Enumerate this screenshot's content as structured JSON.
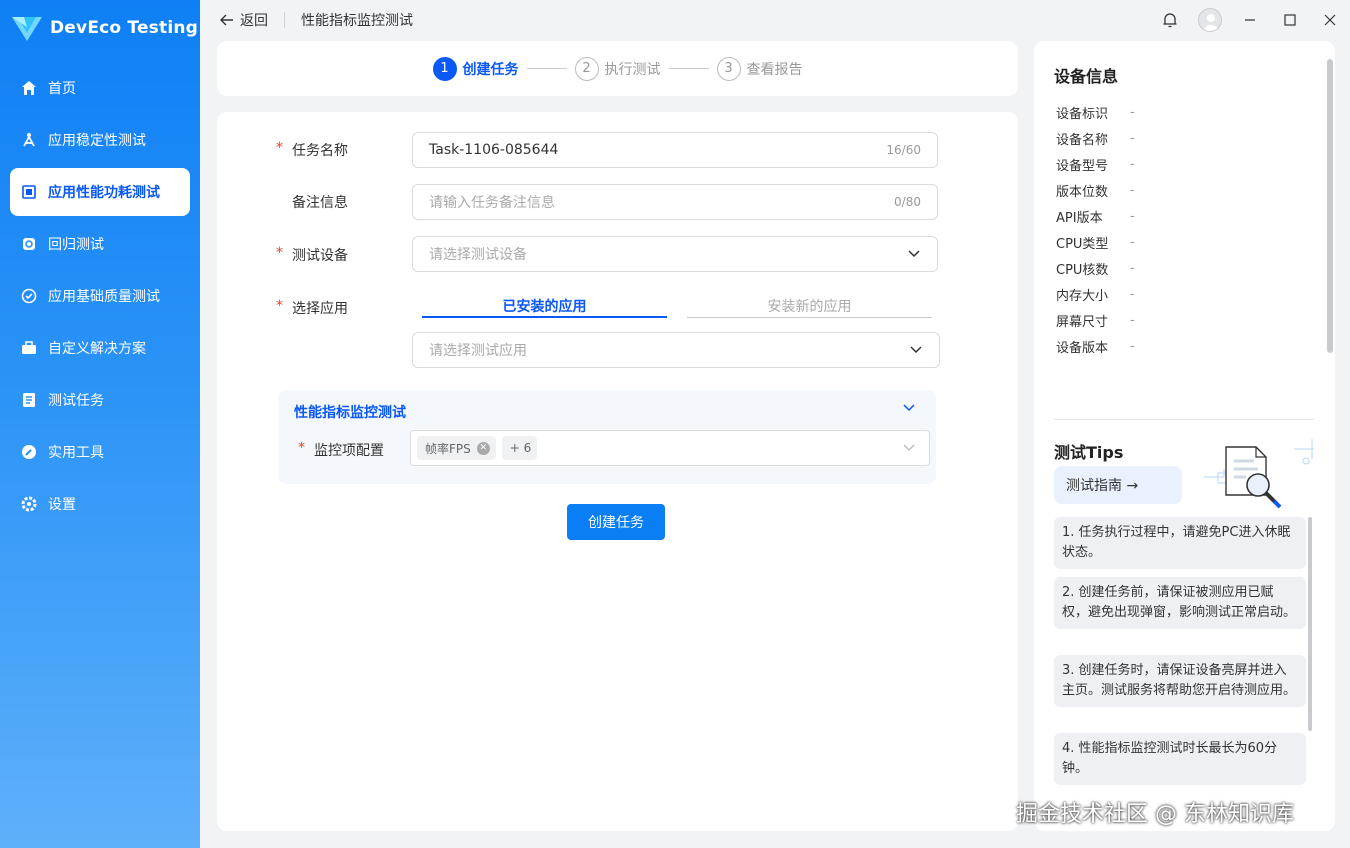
{
  "app": {
    "name": "DevEco Testing"
  },
  "nav": {
    "items": [
      {
        "label": "首页",
        "icon": "home-icon"
      },
      {
        "label": "应用稳定性测试",
        "icon": "stability-icon"
      },
      {
        "label": "应用性能功耗测试",
        "icon": "performance-icon",
        "active": true
      },
      {
        "label": "回归测试",
        "icon": "regression-icon"
      },
      {
        "label": "应用基础质量测试",
        "icon": "quality-icon"
      },
      {
        "label": "自定义解决方案",
        "icon": "toolbox-icon"
      },
      {
        "label": "测试任务",
        "icon": "tasks-icon"
      },
      {
        "label": "实用工具",
        "icon": "tools-icon"
      },
      {
        "label": "设置",
        "icon": "settings-icon"
      }
    ]
  },
  "titlebar": {
    "back_label": "返回",
    "title": "性能指标监控测试"
  },
  "steps": [
    {
      "num": "1",
      "label": "创建任务",
      "active": true
    },
    {
      "num": "2",
      "label": "执行测试"
    },
    {
      "num": "3",
      "label": "查看报告"
    }
  ],
  "form": {
    "task_name": {
      "label": "任务名称",
      "value": "Task-1106-085644",
      "count": "16/60"
    },
    "remark": {
      "label": "备注信息",
      "placeholder": "请输入任务备注信息",
      "count": "0/80"
    },
    "device": {
      "label": "测试设备",
      "placeholder": "请选择测试设备"
    },
    "app": {
      "label": "选择应用",
      "tab_installed": "已安装的应用",
      "tab_new": "安装新的应用",
      "placeholder": "请选择测试应用"
    },
    "perf": {
      "title": "性能指标监控测试",
      "label": "监控项配置",
      "tag": "帧率FPS",
      "more": "+ 6"
    },
    "submit": "创建任务"
  },
  "device_info": {
    "title": "设备信息",
    "rows": [
      {
        "k": "设备标识",
        "v": "-"
      },
      {
        "k": "设备名称",
        "v": "-"
      },
      {
        "k": "设备型号",
        "v": "-"
      },
      {
        "k": "版本位数",
        "v": "-"
      },
      {
        "k": "API版本",
        "v": "-"
      },
      {
        "k": "CPU类型",
        "v": "-"
      },
      {
        "k": "CPU核数",
        "v": "-"
      },
      {
        "k": "内存大小",
        "v": "-"
      },
      {
        "k": "屏幕尺寸",
        "v": "-"
      },
      {
        "k": "设备版本",
        "v": "-"
      }
    ]
  },
  "tips": {
    "title": "测试Tips",
    "guide": "测试指南 →",
    "items": [
      "1. 任务执行过程中，请避免PC进入休眠状态。",
      "2. 创建任务前，请保证被测应用已赋权，避免出现弹窗，影响测试正常启动。",
      "3. 创建任务时，请保证设备亮屏并进入主页。测试服务将帮助您开启待测应用。",
      "4. 性能指标监控测试时长最长为60分钟。"
    ]
  },
  "watermark": "掘金技术社区 @ 东林知识库",
  "colors": {
    "accent": "#0a59f7",
    "button": "#0a7ff5",
    "required": "#e84026"
  }
}
